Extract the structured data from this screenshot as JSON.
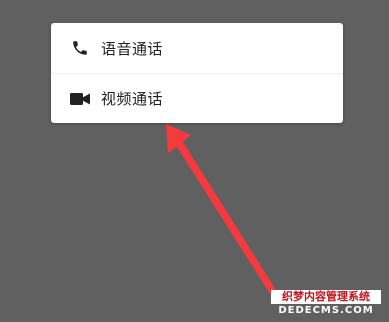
{
  "menu": {
    "items": [
      {
        "label": "语音通话",
        "icon": "phone-icon"
      },
      {
        "label": "视频通话",
        "icon": "video-camera-icon"
      }
    ]
  },
  "annotation": {
    "arrow_color": "#f53a3f"
  },
  "watermark": {
    "line1": "织梦内容管理系统",
    "line2": "DEDECMS.COM"
  },
  "colors": {
    "background": "#606060",
    "menu_bg": "#ffffff",
    "text": "#222222"
  }
}
